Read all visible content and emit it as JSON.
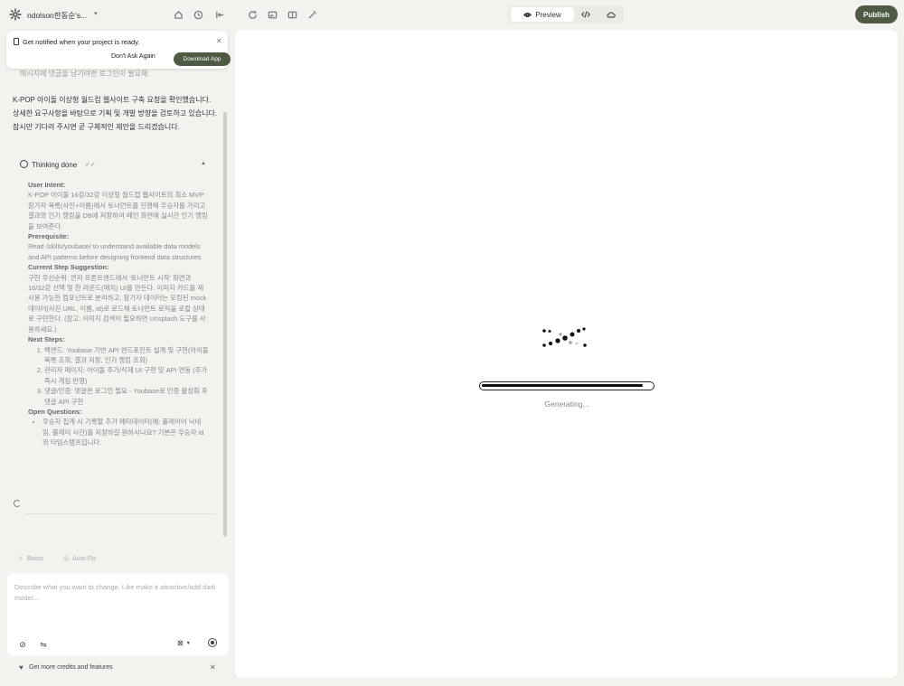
{
  "topbar": {
    "project_title": "ndolson한동순's...",
    "view_toggle": {
      "preview_label": "Preview"
    },
    "publish_label": "Publish"
  },
  "notification": {
    "text": "Get notified when your project is ready.",
    "dont_ask_label": "Don't Ask Again",
    "download_label": "Download App"
  },
  "chat": {
    "faded_line": "메시지에 댓글을 남기려면 로그인이 필요해.",
    "message": "K-POP 아이돌 이상형 월드컵 웹사이트 구축 요청을 확인했습니다. 상세한 요구사항을 바탕으로 기획 및 개발 방향을 검토하고 있습니다. 잠시만 기다려 주시면 곧 구체적인 제안을 드리겠습니다.",
    "thinking": {
      "title": "Thinking done",
      "user_intent_heading": "User Intent:",
      "user_intent": "K-POP 아이돌 16강/32강 이상형 월드컵 웹사이트의 최소 MVP: 참가자 목록(사진+이름)에서 토너먼트를 진행해 우승자를 가리고 결과와 인기 랭킹을 DB에 저장하여 메인 화면에 실시간 인기 랭킹을 보여준다.",
      "prerequisite_heading": "Prerequisite:",
      "prerequisite": "Read /skills/youbase/ to understand available data models and API patterns before designing frontend data structures",
      "current_step_heading": "Current Step Suggestion:",
      "current_step": "구현 우선순위: 먼저 프론트엔드에서 '토너먼트 시작' 화면과 16/32강 선택 및 한 라운드(매치) UI를 만든다. 이미지 카드를 재사용 가능한 컴포넌트로 분리하고, 참가자 데이터는 모킹된 mock 데이터(사진 URL, 이름, id)로 로드해 토너먼트 로직을 로컬 상태로 구현한다. (참고: 이미지 검색이 필요하면 Unsplash 도구를 사용하세요.)",
      "next_steps_heading": "Next Steps:",
      "next_steps": [
        "백엔드: Youbase 기반 API 엔드포인트 설계 및 구현(아이돌 목록 조회, 결과 저장, 인기 랭킹 조회)",
        "관리자 페이지: 아이돌 추가/삭제 UI 구현 및 API 연동 (추가 즉시 게임 반영)",
        "댓글/인증: 댓글은 로그인 필요 - Youbase로 인증 활성화 후 댓글 API 구현"
      ],
      "open_questions_heading": "Open Questions:",
      "open_questions": [
        "우승자 집계 시 기록할 추가 메타데이터(예: 플레이어 닉네임, 플레이 시간)를 저장하길 원하시나요? 기본은 우승자 id와 타임스탬프입니다."
      ]
    }
  },
  "toolbar": {
    "boost_label": "Boost",
    "autofix_label": "Auto-Fix"
  },
  "composer": {
    "placeholder": "Describe what you want to change. Like make it attractive/add dark mode/..."
  },
  "credits": {
    "text": "Get more credits and features"
  },
  "preview": {
    "status": "Generating...",
    "progress": 0.95
  }
}
